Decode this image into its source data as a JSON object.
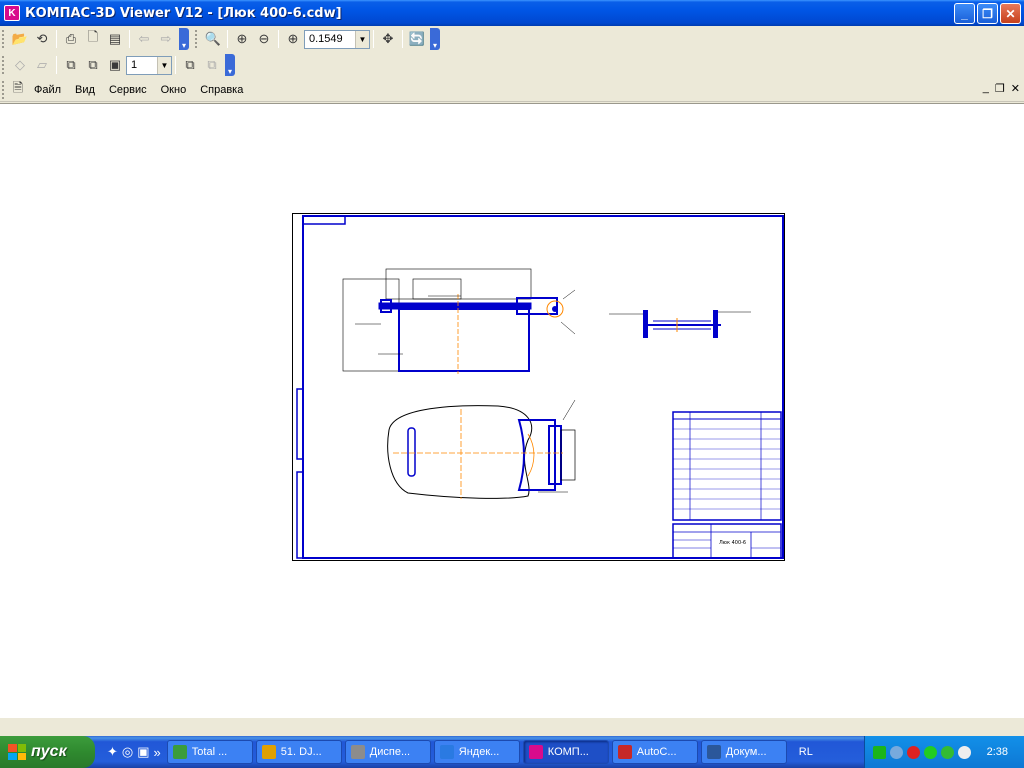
{
  "window": {
    "title": "КОМПАС-3D Viewer V12 - [Люк 400-6.cdw]"
  },
  "toolbar": {
    "zoom_value": "0.1549",
    "page_value": "1"
  },
  "menu": {
    "items": [
      {
        "label": "Файл"
      },
      {
        "label": "Вид"
      },
      {
        "label": "Сервис"
      },
      {
        "label": "Окно"
      },
      {
        "label": "Справка"
      }
    ]
  },
  "drawing": {
    "designation": "Люк 400-6",
    "accent_color": "#0000cc",
    "centerline_color": "#ff8800"
  },
  "taskbar": {
    "start_label": "пуск",
    "tasks": [
      {
        "label": "Total ...",
        "icon_color": "#3b9c3b"
      },
      {
        "label": "51. DJ...",
        "icon_color": "#e0a000"
      },
      {
        "label": "Диспе...",
        "icon_color": "#8c8c8c"
      },
      {
        "label": "Яндек...",
        "icon_color": "#2a7ae2"
      },
      {
        "label": "КОМП...",
        "icon_color": "#d80b8c"
      },
      {
        "label": "AutoC...",
        "icon_color": "#c62828"
      },
      {
        "label": "Докум...",
        "icon_color": "#2b579a"
      }
    ],
    "language": "RL",
    "clock": "2:38"
  }
}
